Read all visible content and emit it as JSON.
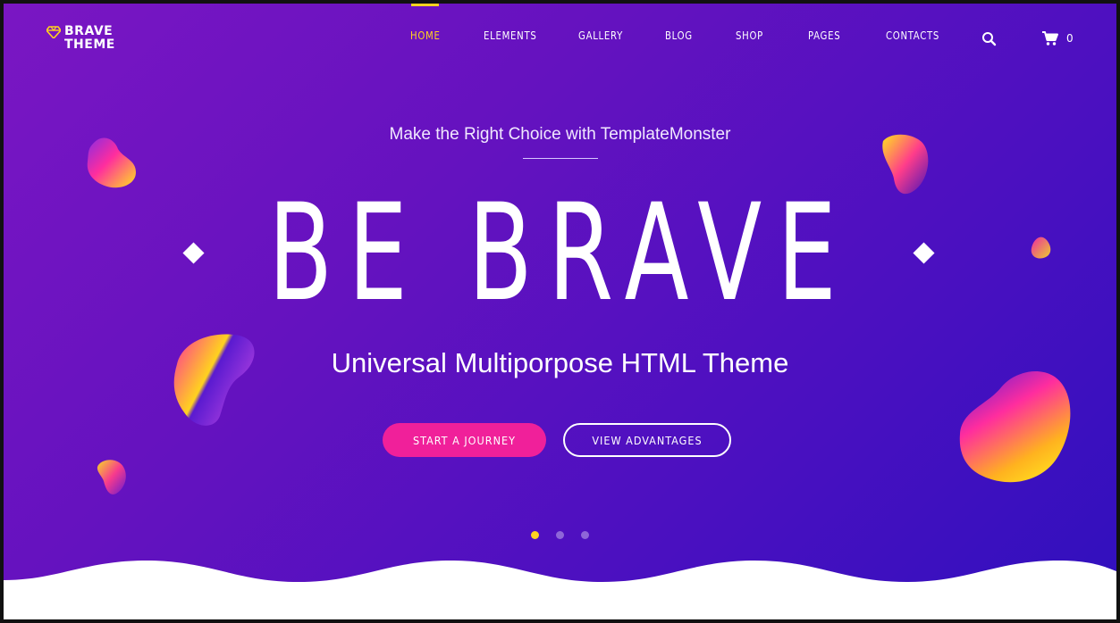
{
  "brand": {
    "line1": "BRAVE",
    "line2": "THEME"
  },
  "nav": {
    "items": [
      {
        "label": "HOME",
        "active": true
      },
      {
        "label": "ELEMENTS",
        "active": false
      },
      {
        "label": "GALLERY",
        "active": false
      },
      {
        "label": "BLOG",
        "active": false
      },
      {
        "label": "SHOP",
        "active": false
      },
      {
        "label": "PAGES",
        "active": false
      },
      {
        "label": "CONTACTS",
        "active": false
      }
    ],
    "search_icon": "search-icon",
    "cart_icon": "cart-icon",
    "cart_count": "0"
  },
  "hero": {
    "subtitle": "Make the Right Choice with TemplateMonster",
    "headline": "BE BRAVE",
    "tagline": "Universal Multiporpose HTML Theme",
    "primary_button": "START A JOURNEY",
    "secondary_button": "VIEW ADVANTAGES",
    "slides": {
      "count": 3,
      "active_index": 0
    }
  },
  "colors": {
    "accent_yellow": "#ffd21f",
    "accent_pink": "#f0209a",
    "gradient_start": "#7a16c3",
    "gradient_end": "#3010be"
  }
}
